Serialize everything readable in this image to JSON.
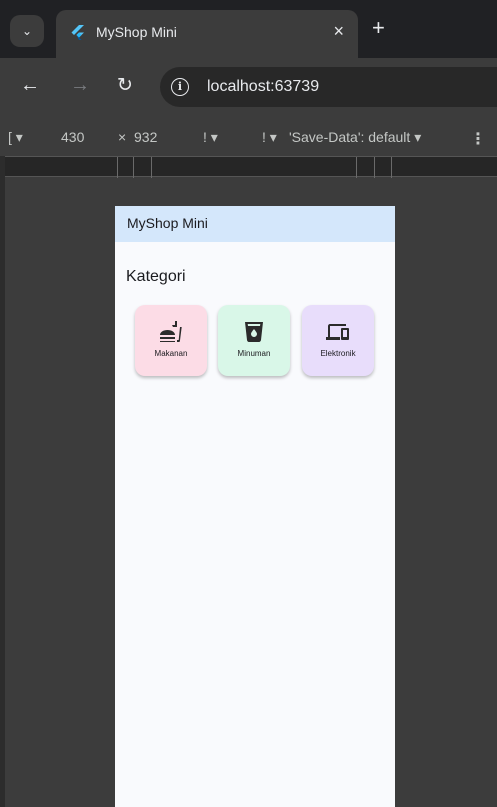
{
  "browser": {
    "tab_title": "MyShop Mini",
    "tab_close": "×",
    "new_tab": "+",
    "url": "localhost:63739",
    "info_glyph": "i"
  },
  "devtools": {
    "dimensions_menu": "[ ▾",
    "width": "430",
    "times": "×",
    "height": "932",
    "zoom_menu": "! ▾",
    "throttle_menu": "! ▾",
    "save_data": "'Save-Data': default ▾",
    "more_menu": "⋮"
  },
  "app": {
    "title": "MyShop Mini",
    "section_title": "Kategori",
    "categories": [
      {
        "label": "Makanan",
        "icon": "fastfood-icon",
        "color": "#fcdce6"
      },
      {
        "label": "Minuman",
        "icon": "drink-cup-icon",
        "color": "#d9f7e8"
      },
      {
        "label": "Elektronik",
        "icon": "devices-icon",
        "color": "#e8ddfb"
      }
    ]
  }
}
